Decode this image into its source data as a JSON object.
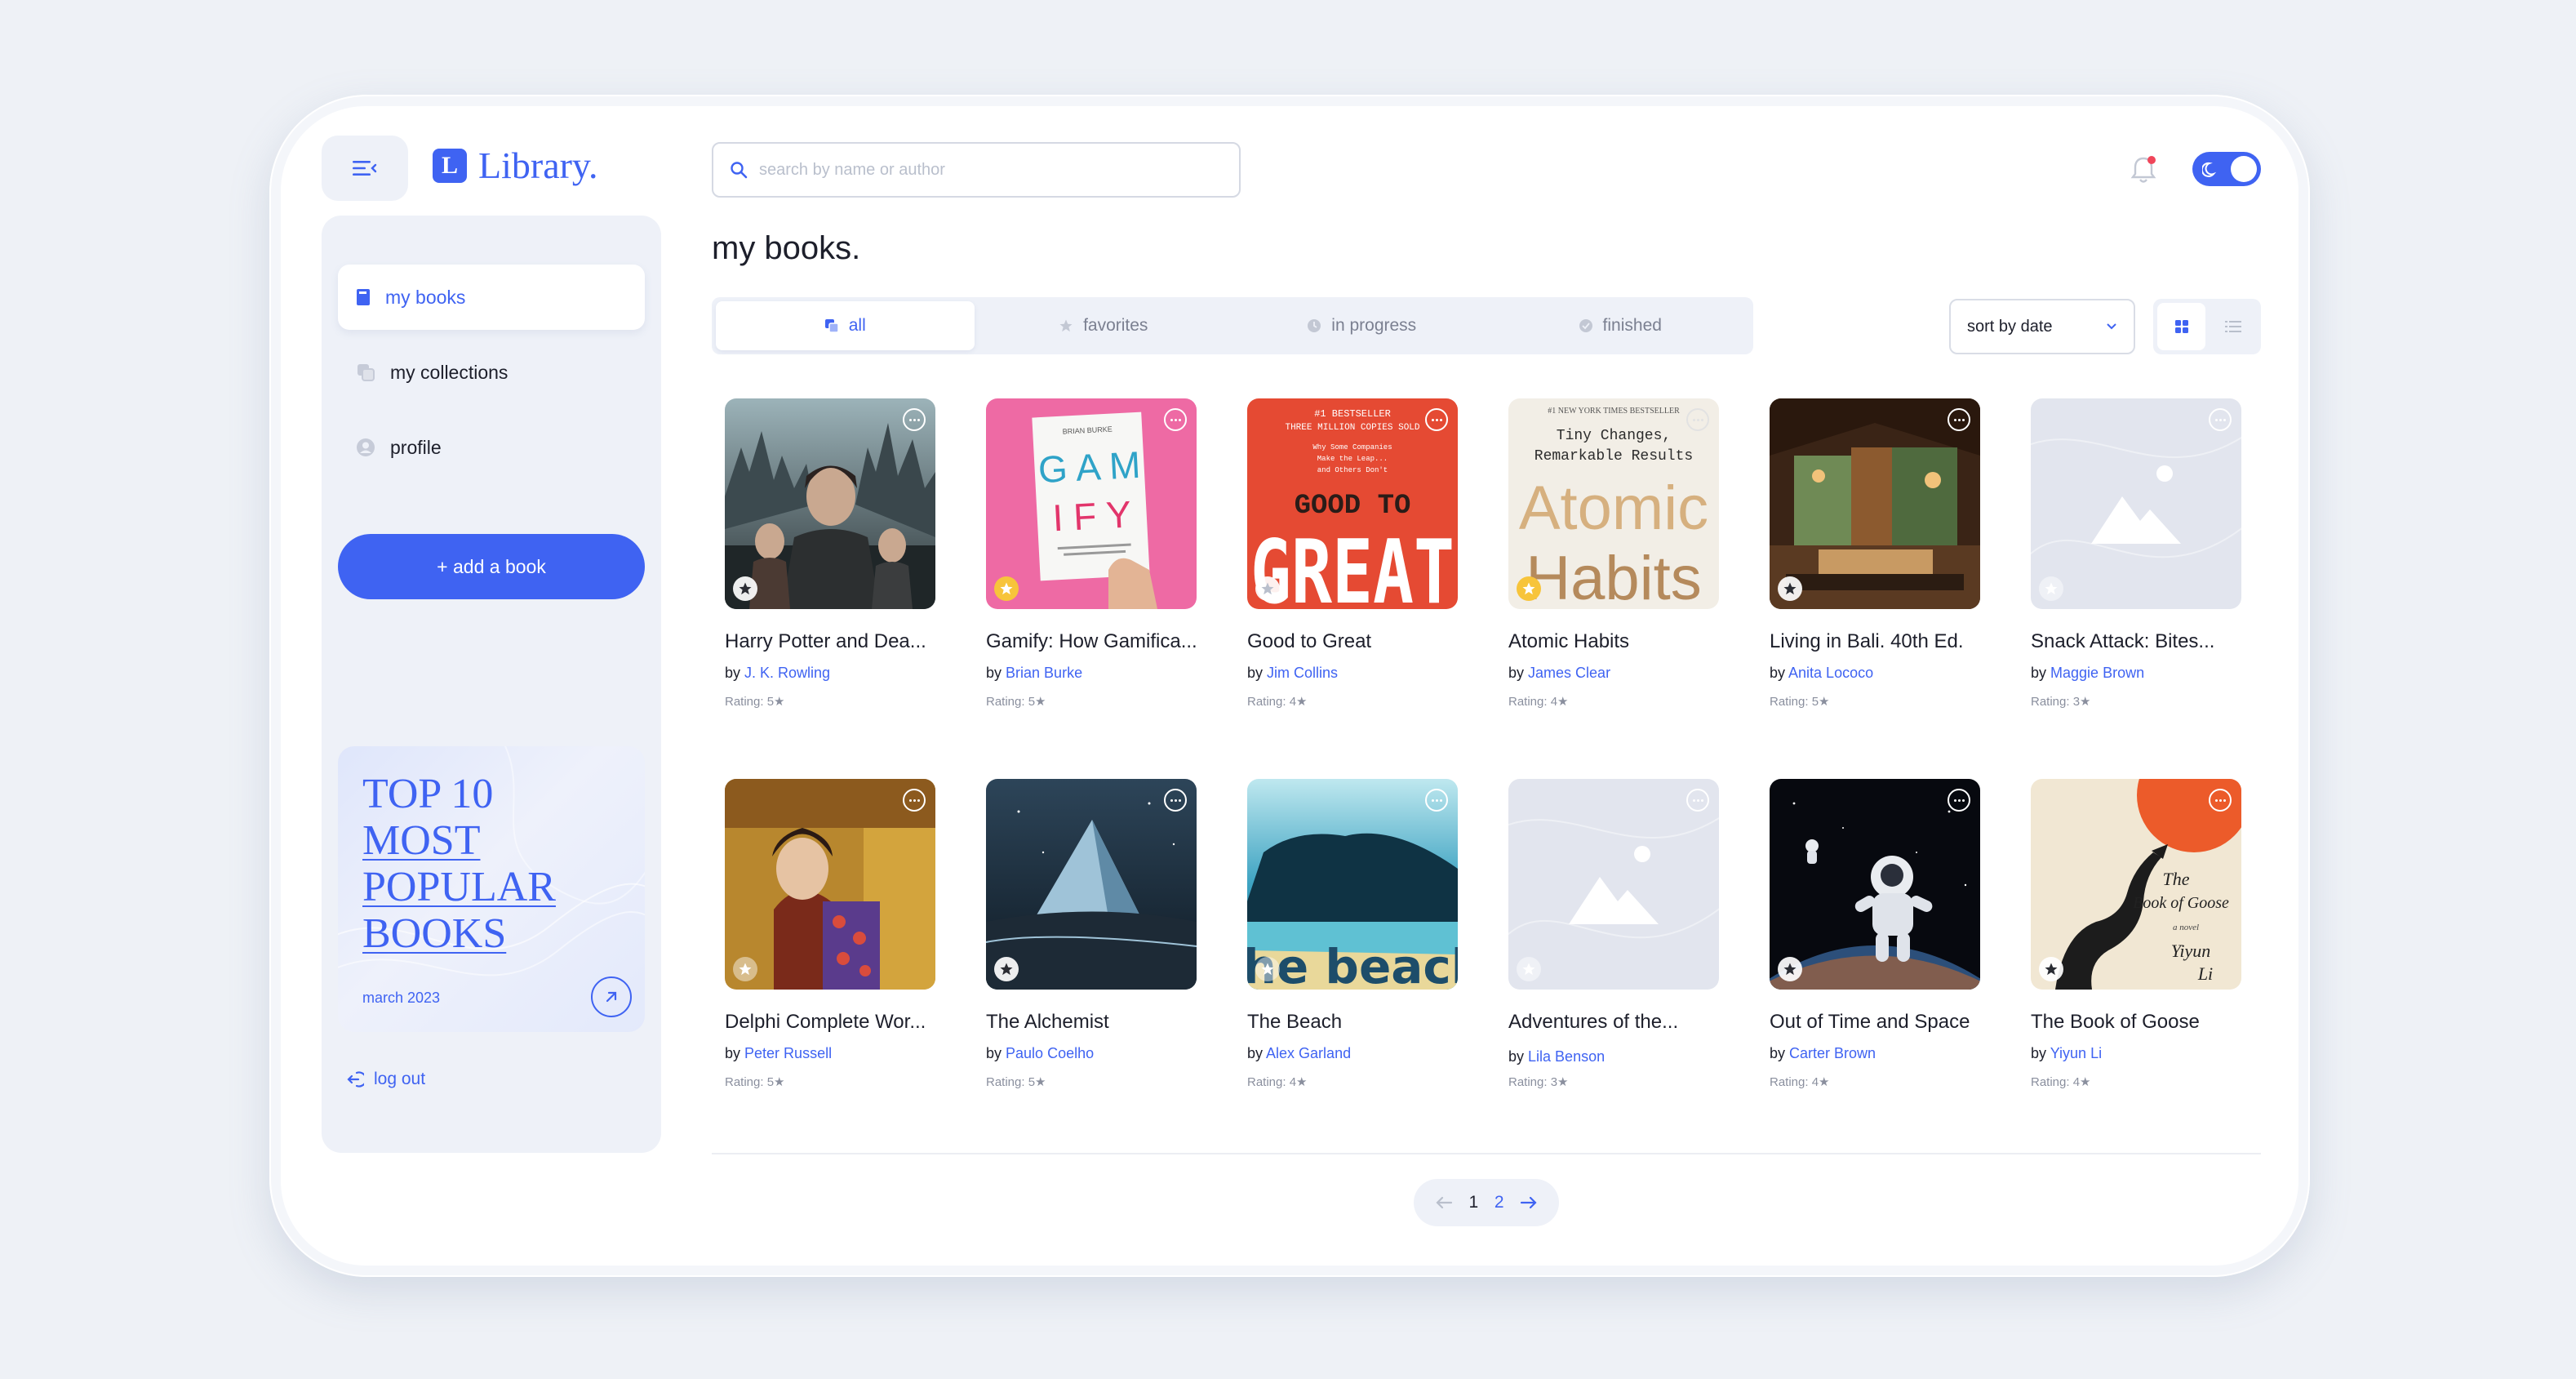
{
  "app": {
    "logo_letter": "L",
    "logo_text": "Library."
  },
  "search": {
    "placeholder": "search by name or author",
    "value": ""
  },
  "sidebar": {
    "items": [
      {
        "label": "my books",
        "icon": "book-icon",
        "active": true
      },
      {
        "label": "my collections",
        "icon": "collections-icon",
        "active": false
      },
      {
        "label": "profile",
        "icon": "profile-icon",
        "active": false
      }
    ],
    "add_book_label": "+ add a book",
    "promo": {
      "lines": [
        "TOP 10",
        "MOST",
        "POPULAR",
        "BOOKS"
      ],
      "date": "march 2023"
    },
    "logout_label": "log out"
  },
  "main": {
    "title": "my books.",
    "tabs": [
      {
        "label": "all",
        "icon": "copy-icon",
        "active": true
      },
      {
        "label": "favorites",
        "icon": "star-icon",
        "active": false
      },
      {
        "label": "in progress",
        "icon": "clock-icon",
        "active": false
      },
      {
        "label": "finished",
        "icon": "check-circle-icon",
        "active": false
      }
    ],
    "sort_label": "sort by date",
    "view_mode": "grid"
  },
  "books": [
    {
      "title": "Harry Potter and Dea...",
      "by": "by",
      "author": "J. K. Rowling",
      "rating": "Rating: 5★",
      "favorite": false
    },
    {
      "title": "Gamify: How Gamifica...",
      "by": "by",
      "author": "Brian Burke",
      "rating": "Rating: 5★",
      "favorite": true
    },
    {
      "title": "Good to Great",
      "by": "by",
      "author": "Jim Collins",
      "rating": "Rating: 4★",
      "favorite": false
    },
    {
      "title": "Atomic Habits",
      "by": "by",
      "author": "James Clear",
      "rating": "Rating: 4★",
      "favorite": true
    },
    {
      "title": "Living in Bali. 40th Ed.",
      "by": "by",
      "author": "Anita Lococo",
      "rating": "Rating: 5★",
      "favorite": false
    },
    {
      "title": "Snack Attack: Bites...",
      "by": "by",
      "author": "Maggie Brown",
      "rating": "Rating: 3★",
      "favorite": false
    },
    {
      "title": "Delphi Complete Wor...",
      "by": "by",
      "author": "Peter Russell",
      "rating": "Rating: 5★",
      "favorite": false
    },
    {
      "title": "The Alchemist",
      "by": "by",
      "author": "Paulo Coelho",
      "rating": "Rating: 5★",
      "favorite": false
    },
    {
      "title": "The Beach",
      "by": "by",
      "author": "Alex Garland",
      "rating": "Rating: 4★",
      "favorite": false
    },
    {
      "title": "Adventures of the...",
      "by": "by",
      "author": "Lila Benson",
      "rating": "Rating: 3★",
      "favorite": false
    },
    {
      "title": "Out of Time and Space",
      "by": "by",
      "author": "Carter Brown",
      "rating": "Rating: 4★",
      "favorite": false
    },
    {
      "title": "The Book of Goose",
      "by": "by",
      "author": "Yiyun Li",
      "rating": "Rating: 4★",
      "favorite": false
    }
  ],
  "covers": {
    "gamify": {
      "author": "BRIAN BURKE",
      "l1": "G A M",
      "l2": "I F Y"
    },
    "good_to_great": {
      "top1": "#1 BESTSELLER",
      "top2": "THREE MILLION COPIES SOLD",
      "sub1": "Why Some Companies",
      "sub2": "Make the Leap...",
      "sub3": "and Others Don't",
      "l1": "GOOD TO",
      "l2": "GREAT"
    },
    "atomic_habits": {
      "top": "#1 NEW YORK TIMES BESTSELLER",
      "sub1": "Tiny Changes,",
      "sub2": "Remarkable Results",
      "l1": "Atomic",
      "l2": "Habits"
    },
    "the_beach": {
      "word": "the beach"
    },
    "goose": {
      "l1": "The",
      "l2": "Book of Goose",
      "l3": "a novel",
      "l4": "Yiyun",
      "l5": "Li"
    }
  },
  "pagination": {
    "current": "1",
    "pages": [
      "1",
      "2"
    ]
  },
  "colors": {
    "accent": "#3f63f2",
    "favorite": "#f7c43b",
    "panel": "#eef1f8"
  }
}
